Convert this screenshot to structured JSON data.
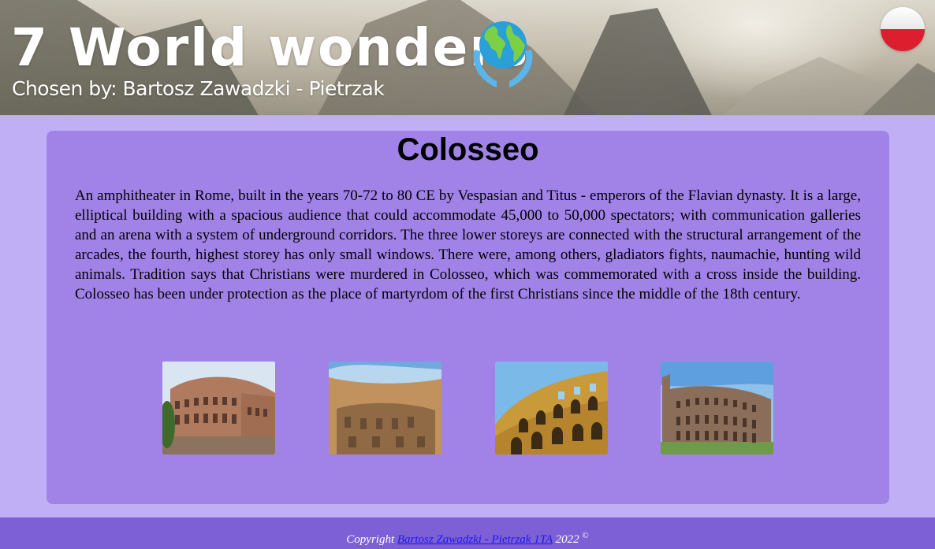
{
  "header": {
    "title": "7 World wonders",
    "subtitle": "Chosen by: Bartosz Zawadzki - Pietrzak",
    "globe_icon": "globe-in-hands-icon",
    "language_flag": "poland-flag-icon"
  },
  "wonder": {
    "title": "Colosseo",
    "description": "An amphitheater in Rome, built in the years 70-72 to 80 CE by Vespasian and Titus - emperors of the Flavian dynasty. It is a large, elliptical building with a spacious audience that could accommodate 45,000 to 50,000 spectators; with communication galleries and an arena with a system of underground corridors. The three lower storeys are connected with the structural arrangement of the arcades, the fourth, highest storey has only small windows. There were, among others, gladiators fights, naumachie, hunting wild animals. Tradition says that Christians were murdered in Colosseo, which was commemorated with a cross inside the building. Colosseo has been under protection as the place of martyrdom of the first Christians since the middle of the 18th century."
  },
  "footer": {
    "prefix": "Copyright",
    "author_link": "Bartosz Zawadzki - Pietrzak 1TA",
    "year": "2022",
    "copyright_symbol": "©"
  },
  "colors": {
    "page_background": "#c0aff5",
    "card_background": "#a183e8",
    "footer_background": "#7d5fd6",
    "link": "#1a1aee",
    "flag_red": "#dc1f2e"
  }
}
